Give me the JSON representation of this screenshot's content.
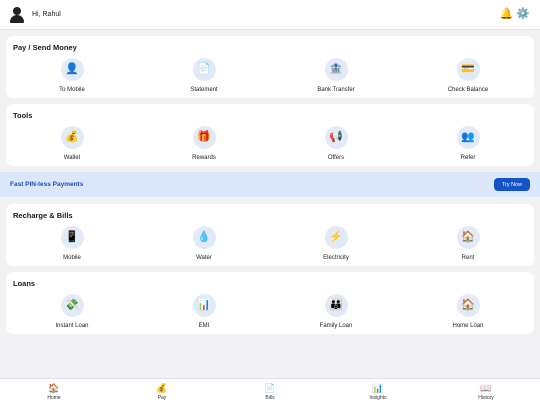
{
  "header": {
    "greeting": "Hi, Rahul",
    "icons": [
      "bell-icon",
      "gear-icon"
    ],
    "bell_glyph": "🔔",
    "gear_glyph": "⚙️"
  },
  "sections": [
    {
      "title": "Pay / Send Money",
      "items": [
        {
          "label": "To Mobile",
          "icon": "person-icon",
          "glyph": "👤"
        },
        {
          "label": "Statement",
          "icon": "document-icon",
          "glyph": "📄"
        },
        {
          "label": "Bank Transfer",
          "icon": "bank-icon",
          "glyph": "🏦"
        },
        {
          "label": "Check Balance",
          "icon": "card-icon",
          "glyph": "💳"
        }
      ]
    },
    {
      "title": "Tools",
      "items": [
        {
          "label": "Wallet",
          "icon": "money-bag-icon",
          "glyph": "💰"
        },
        {
          "label": "Rewards",
          "icon": "gift-icon",
          "glyph": "🎁"
        },
        {
          "label": "Offers",
          "icon": "megaphone-icon",
          "glyph": "📢"
        },
        {
          "label": "Refer",
          "icon": "people-icon",
          "glyph": "👥"
        }
      ]
    },
    {
      "title": "Recharge & Bills",
      "items": [
        {
          "label": "Mobile",
          "icon": "phone-icon",
          "glyph": "📱"
        },
        {
          "label": "Water",
          "icon": "water-drop-icon",
          "glyph": "💧"
        },
        {
          "label": "Electricity",
          "icon": "lightning-icon",
          "glyph": "⚡"
        },
        {
          "label": "Rent",
          "icon": "house-icon",
          "glyph": "🏠"
        }
      ]
    },
    {
      "title": "Loans",
      "items": [
        {
          "label": "Instant Loan",
          "icon": "money-icon",
          "glyph": "💸"
        },
        {
          "label": "EMI",
          "icon": "chart-icon",
          "glyph": "📊"
        },
        {
          "label": "Family Loan",
          "icon": "family-icon",
          "glyph": "👪"
        },
        {
          "label": "Home Loan",
          "icon": "house-icon",
          "glyph": "🏠"
        }
      ]
    }
  ],
  "promo": {
    "title": "Fast PIN-less Payments",
    "button": "Try Now"
  },
  "bottom_nav": [
    {
      "label": "Home",
      "icon": "home-icon",
      "glyph": "🏠"
    },
    {
      "label": "Pay",
      "icon": "money-bag-icon",
      "glyph": "💰"
    },
    {
      "label": "Bills",
      "icon": "document-icon",
      "glyph": "📄"
    },
    {
      "label": "Insights",
      "icon": "chart-icon",
      "glyph": "📊"
    },
    {
      "label": "History",
      "icon": "book-icon",
      "glyph": "📖"
    }
  ],
  "colors": {
    "accent": "#1553c6",
    "promo_bg": "#dce7fb",
    "icon_circle": "#e3eaf7"
  }
}
